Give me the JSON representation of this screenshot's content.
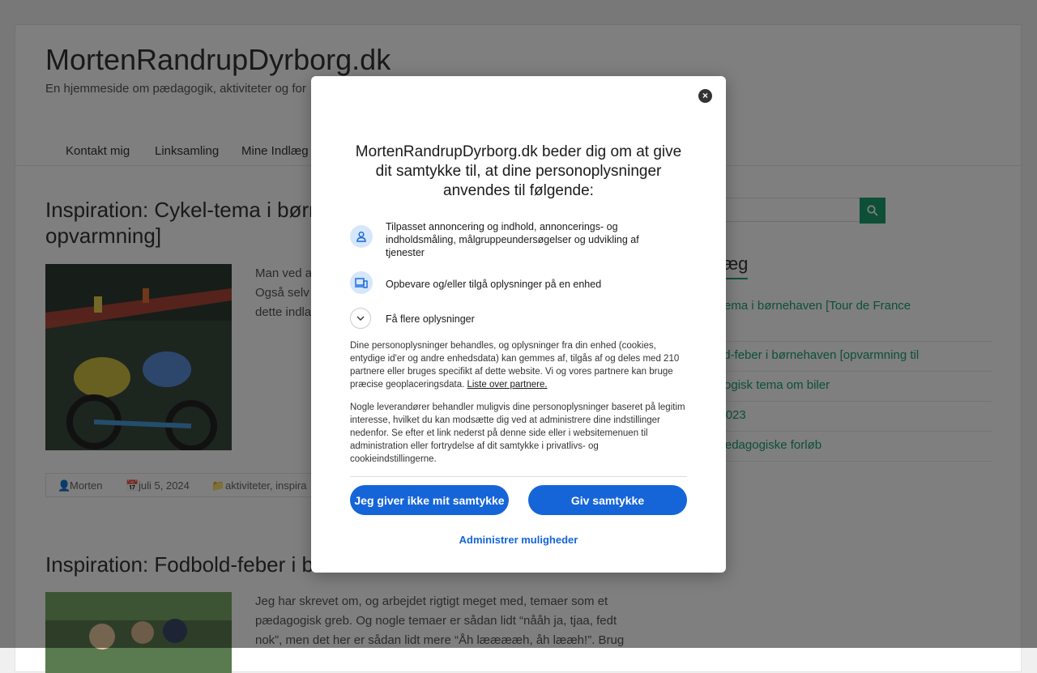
{
  "site": {
    "title": "MortenRandrupDyrborg.dk",
    "tagline": "En hjemmeside om pædagogik, aktiviteter og for"
  },
  "nav": {
    "items": [
      "Kontakt mig",
      "Linksamling",
      "Mine Indlæg"
    ]
  },
  "posts": [
    {
      "title": "Inspiration: Cykel-tema i børn\nopvarmning]",
      "excerpt_lines": [
        "Man ved a",
        "Også selv",
        "dette indla"
      ],
      "meta": {
        "author": "Morten",
        "date": "juli 5, 2024",
        "categories": "aktiviteter, inspira"
      }
    },
    {
      "title": "Inspiration: Fodbold-feber i b",
      "excerpt": "Jeg har skrevet om, og arbejdet rigtigt meget med, temaer som et pædagogisk greb. Og nogle temaer er sådan lidt “nååh ja, tjaa, fedt nok”, men det her er sådan lidt mere “Åh lææææh, åh lææh!”. Brug"
    }
  ],
  "sidebar": {
    "recent_title": "e indlæg",
    "recent_items": [
      ": Cykel-tema i børnehaven [Tour de France\ng]",
      ": Fodbold-feber i børnehaven [opvarmning til",
      ": pædagogisk tema om biler",
      " kursus 2023",
      "erede pædagogiske forløb"
    ]
  },
  "consent": {
    "heading": "MortenRandrupDyrborg.dk beder dig om at give dit samtykke til, at dine personoplysninger anvendes til følgende:",
    "purposes": [
      {
        "icon": "person-icon",
        "text": "Tilpasset annoncering og indhold, annoncerings- og indholdsmåling, målgruppeundersøgelser og udvikling af tjenester"
      },
      {
        "icon": "devices-icon",
        "text": "Opbevare og/eller tilgå oplysninger på en enhed"
      }
    ],
    "more_label": "Få flere oplysninger",
    "info1": "Dine personoplysninger behandles, og oplysninger fra din enhed (cookies, entydige id'er og andre enhedsdata) kan gemmes af, tilgås af og deles med 210 partnere eller bruges specifikt af dette website. Vi og vores partnere kan bruge præcise geoplaceringsdata.",
    "partners_link": "Liste over partnere.",
    "info2": "Nogle leverandører behandler muligvis dine personoplysninger baseret på legitim interesse, hvilket du kan modsætte dig ved at administrere dine indstillinger nedenfor. Se efter et link nederst på denne side eller i websitemenuen til administration eller fortrydelse af dit samtykke i privatlivs- og cookieindstillingerne.",
    "decline_label": "Jeg giver ikke mit samtykke",
    "accept_label": "Giv samtykke",
    "manage_label": "Administrer muligheder",
    "close_symbol": "×"
  }
}
